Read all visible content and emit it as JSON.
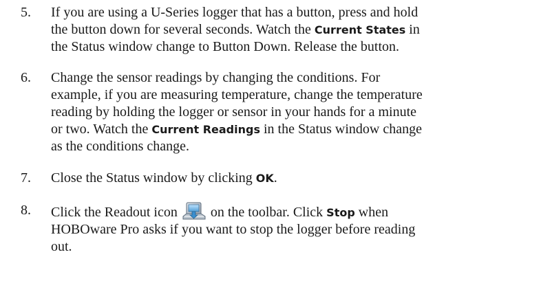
{
  "steps": [
    {
      "number": "5.",
      "lines": [
        {
          "text": "If you are using a U-Series logger that has a button, press and hold"
        },
        {
          "before": "the button down for several seconds. Watch the ",
          "ui": "Current States",
          "after": " in"
        },
        {
          "text": "the Status window change to Button Down. Release the button."
        }
      ]
    },
    {
      "number": "6.",
      "lines": [
        {
          "text": "Change the sensor readings by changing the conditions. For"
        },
        {
          "text": "example, if you are measuring temperature, change the temperature"
        },
        {
          "text": "reading by holding the logger or sensor in your hands for a minute"
        },
        {
          "before": "or two. Watch the ",
          "ui": "Current Readings",
          "after": " in the Status window change"
        },
        {
          "text": "as the conditions change."
        }
      ]
    },
    {
      "number": "7.",
      "lines": [
        {
          "before": "Close the Status window by clicking ",
          "ui": "OK",
          "after": "."
        }
      ]
    },
    {
      "number": "8.",
      "lines": [
        {
          "before": "Click the Readout icon ",
          "icon": "readout-icon",
          "after_icon": " on the toolbar. Click ",
          "ui": "Stop",
          "after": " when"
        },
        {
          "text": "HOBOware Pro asks if you want to stop the logger before reading"
        },
        {
          "text": "out."
        }
      ]
    }
  ]
}
